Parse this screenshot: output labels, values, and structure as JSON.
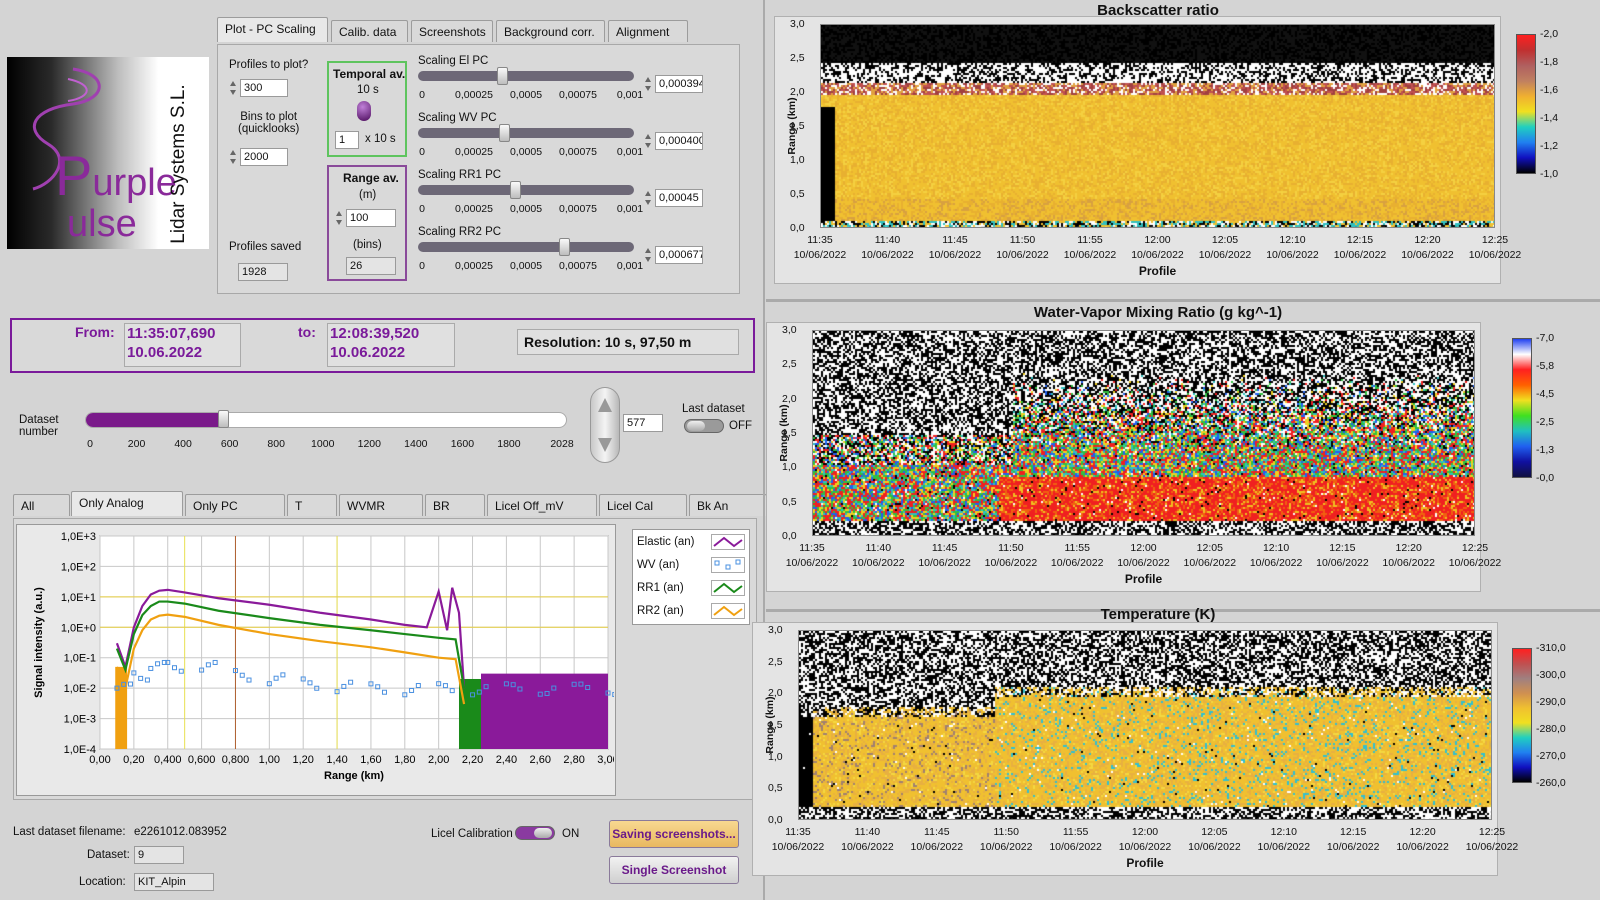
{
  "logo": {
    "company": "Lidar Systems S.L.",
    "word1": "urple",
    "word2": "ulse"
  },
  "top_tabs": [
    "Plot - PC Scaling",
    "Calib. data",
    "Screenshots",
    "Background corr.",
    "Alignment"
  ],
  "profiles_to_plot": {
    "label": "Profiles to plot?",
    "value": "300"
  },
  "bins_to_plot": {
    "label": "Bins to plot\n(quicklooks)",
    "value": "2000"
  },
  "profiles_saved": {
    "label": "Profiles saved",
    "value": "1928"
  },
  "temporal_av": {
    "label": "Temporal av.",
    "value_text": "10 s",
    "factor": "1",
    "unit": "x 10 s"
  },
  "range_av": {
    "label": "Range av.",
    "unit_m": "(m)",
    "value_m": "100",
    "unit_bins": "(bins)",
    "value_bins": "26"
  },
  "scalings": [
    {
      "label": "Scaling El PC",
      "value": "0,000394",
      "level": 0.39
    },
    {
      "label": "Scaling WV PC",
      "value": "0,000400",
      "level": 0.4
    },
    {
      "label": "Scaling RR1 PC",
      "value": "0,00045",
      "level": 0.45
    },
    {
      "label": "Scaling RR2 PC",
      "value": "0,000677",
      "level": 0.677
    }
  ],
  "scaling_ticks": [
    "0",
    "0,00025",
    "0,0005",
    "0,00075",
    "0,001"
  ],
  "time_range": {
    "from_label": "From:",
    "from_time": "11:35:07,690",
    "from_date": "10.06.2022",
    "to_label": "to:",
    "to_time": "12:08:39,520",
    "to_date": "10.06.2022",
    "resolution": "Resolution: 10 s, 97,50 m"
  },
  "dataset": {
    "label": "Dataset\nnumber",
    "value": "577",
    "level": 577,
    "max": 2028,
    "ticks": [
      "0",
      "200",
      "400",
      "600",
      "800",
      "1000",
      "1200",
      "1400",
      "1600",
      "1800",
      "2028"
    ],
    "last_label": "Last dataset",
    "last_state": "OFF"
  },
  "bottom_tabs": [
    "All",
    "Only Analog",
    "Only PC",
    "T",
    "WVMR",
    "BR",
    "Licel Off_mV",
    "Licel Cal",
    "Bk An"
  ],
  "footer": {
    "filename_label": "Last dataset filename:",
    "filename": "e2261012.083952",
    "dataset_label": "Dataset:",
    "dataset_value": "9",
    "location_label": "Location:",
    "location_value": "KIT_Alpin",
    "licel_label": "Licel Calibration",
    "licel_state": "ON",
    "save_btn": "Saving screenshots...",
    "single_btn": "Single Screenshot"
  },
  "colors": {
    "accent": "#7a1a9a",
    "elastic": "#8a1a9a",
    "wv": "#4a90e0",
    "rr1": "#1a8a1a",
    "rr2": "#f0a010"
  },
  "chart_data": [
    {
      "type": "line",
      "xlabel": "Range (km)",
      "ylabel": "Signal intensity (a.u.)",
      "x_ticks": [
        "0,00",
        "0,20",
        "0,400",
        "0,600",
        "0,800",
        "1,00",
        "1,20",
        "1,40",
        "1,60",
        "1,80",
        "2,00",
        "2,20",
        "2,40",
        "2,60",
        "2,80",
        "3,00"
      ],
      "y_ticks": [
        "1,0E+3",
        "1,0E+2",
        "1,0E+1",
        "1,0E+0",
        "1,0E-1",
        "1,0E-2",
        "1,0E-3",
        "1,0E-4"
      ],
      "xlim": [
        0,
        3
      ],
      "ylim_log10": [
        -4,
        3
      ],
      "y_scale": "log",
      "legend": [
        "Elastic (an)",
        "WV (an)",
        "RR1 (an)",
        "RR2 (an)"
      ],
      "series": [
        {
          "name": "Elastic (an)",
          "x": [
            0.1,
            0.15,
            0.2,
            0.25,
            0.3,
            0.35,
            0.4,
            0.5,
            0.7,
            1.0,
            1.3,
            1.6,
            1.8,
            1.93,
            2.0,
            2.05,
            2.08,
            2.12,
            2.15
          ],
          "y": [
            0.3,
            0.05,
            1.0,
            5,
            12,
            16,
            17,
            14,
            9,
            5.5,
            3.0,
            1.8,
            1.2,
            1.0,
            15,
            0.8,
            20,
            3,
            0.01
          ]
        },
        {
          "name": "RR1 (an)",
          "x": [
            0.1,
            0.15,
            0.2,
            0.25,
            0.3,
            0.35,
            0.4,
            0.5,
            0.7,
            1.0,
            1.3,
            1.6,
            1.8,
            2.0,
            2.1,
            2.15
          ],
          "y": [
            0.2,
            0.04,
            0.6,
            2.5,
            5,
            7,
            7,
            6,
            3.5,
            2.0,
            1.2,
            0.8,
            0.6,
            0.45,
            0.4,
            0.01
          ]
        },
        {
          "name": "RR2 (an)",
          "x": [
            0.1,
            0.15,
            0.2,
            0.25,
            0.3,
            0.35,
            0.4,
            0.5,
            0.7,
            1.0,
            1.3,
            1.6,
            1.8,
            2.0,
            2.1,
            2.15
          ],
          "y": [
            0.05,
            0.01,
            0.2,
            0.8,
            1.8,
            2.4,
            2.6,
            2.2,
            1.2,
            0.6,
            0.35,
            0.22,
            0.15,
            0.1,
            0.09,
            0.003
          ]
        },
        {
          "name": "WV (an)",
          "x": [
            0.1,
            0.2,
            0.3,
            0.4,
            0.6,
            0.8,
            1.0,
            1.2,
            1.4,
            1.6,
            1.8,
            2.0,
            2.2,
            2.4,
            2.6,
            2.8,
            3.0
          ],
          "y": [
            0.01,
            0.03,
            0.05,
            0.06,
            0.05,
            0.03,
            0.02,
            0.015,
            0.012,
            0.01,
            0.01,
            0.01,
            0.01,
            0.01,
            0.01,
            0.01,
            0.01
          ]
        }
      ]
    },
    {
      "type": "heatmap",
      "title": "Backscatter ratio",
      "xlabel": "Profile",
      "ylabel": "Range (km)",
      "y_ticks": [
        "0,0",
        "0,5",
        "1,0",
        "1,5",
        "2,0",
        "2,5",
        "3,0"
      ],
      "x_ticks": [
        "11:35",
        "11:40",
        "11:45",
        "11:50",
        "11:55",
        "12:00",
        "12:05",
        "12:10",
        "12:15",
        "12:20",
        "12:25"
      ],
      "x_date": "10/06/2022",
      "cbar_ticks": [
        "2,0",
        "1,8",
        "1,6",
        "1,4",
        "1,2",
        "1,0"
      ]
    },
    {
      "type": "heatmap",
      "title": "Water-Vapor Mixing Ratio  (g kg^-1)",
      "xlabel": "Profile",
      "ylabel": "Range (km)",
      "y_ticks": [
        "0,0",
        "0,5",
        "1,0",
        "1,5",
        "2,0",
        "2,5",
        "3,0"
      ],
      "x_ticks": [
        "11:35",
        "11:40",
        "11:45",
        "11:50",
        "11:55",
        "12:00",
        "12:05",
        "12:10",
        "12:15",
        "12:20",
        "12:25"
      ],
      "x_date": "10/06/2022",
      "cbar_ticks": [
        "7,0",
        "5,8",
        "4,5",
        "2,5",
        "1,3",
        "0,0"
      ]
    },
    {
      "type": "heatmap",
      "title": "Temperature (K)",
      "xlabel": "Profile",
      "ylabel": "Range (km)",
      "y_ticks": [
        "0,0",
        "0,5",
        "1,0",
        "1,5",
        "2,0",
        "2,5",
        "3,0"
      ],
      "x_ticks": [
        "11:35",
        "11:40",
        "11:45",
        "11:50",
        "11:55",
        "12:00",
        "12:05",
        "12:10",
        "12:15",
        "12:20",
        "12:25"
      ],
      "x_date": "10/06/2022",
      "cbar_ticks": [
        "310,0",
        "300,0",
        "290,0",
        "280,0",
        "270,0",
        "260,0"
      ]
    }
  ]
}
